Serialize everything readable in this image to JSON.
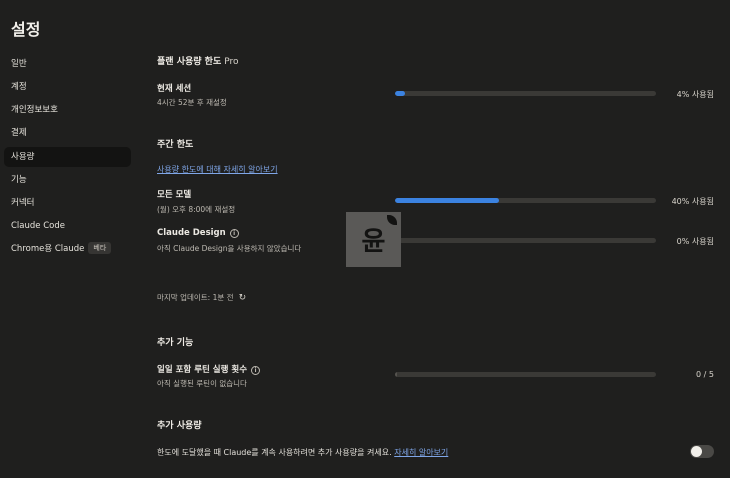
{
  "page": {
    "title": "설정"
  },
  "sidebar": {
    "items": [
      {
        "label": "일반"
      },
      {
        "label": "계정"
      },
      {
        "label": "개인정보보호"
      },
      {
        "label": "결제"
      },
      {
        "label": "사용량"
      },
      {
        "label": "기능"
      },
      {
        "label": "커넥터"
      },
      {
        "label": "Claude Code"
      },
      {
        "label": "Chrome용 Claude",
        "badge": "베타"
      }
    ]
  },
  "plan_limits": {
    "title": "플랜 사용량 한도",
    "plan": "Pro",
    "current_session": {
      "label": "현재 세션",
      "reset": "4시간 52분 후 재설정",
      "percent": 4,
      "status": "4% 사용됨"
    }
  },
  "weekly_limits": {
    "title": "주간 한도",
    "learn_link": "사용량 한도에 대해 자세히 알아보기",
    "all_models": {
      "label": "모든 모델",
      "reset": "(월) 오후 8:00에 재설정",
      "percent": 40,
      "status": "40% 사용됨"
    },
    "claude_design": {
      "label": "Claude Design",
      "sub": "아직 Claude Design을 사용하지 않았습니다",
      "percent": 0,
      "status": "0% 사용됨"
    },
    "last_updated": "마지막 업데이트: 1분 전"
  },
  "additional_features": {
    "title": "추가 기능",
    "routine": {
      "label": "일일 포함 루틴 실행 횟수",
      "sub": "아직 실행된 루틴이 없습니다",
      "used": 0,
      "total": 5,
      "status": "0 / 5"
    }
  },
  "extra_usage": {
    "title": "추가 사용량",
    "description": "한도에 도달했을 때 Claude를 계속 사용하려면 추가 사용량을 켜세요.",
    "learn_link": "자세히 알아보기",
    "enabled": false
  },
  "watermark": {
    "glyph": "윤"
  },
  "colors": {
    "accent": "#3b82e0",
    "link": "#7fa6e8",
    "background": "#1f1f1e"
  }
}
